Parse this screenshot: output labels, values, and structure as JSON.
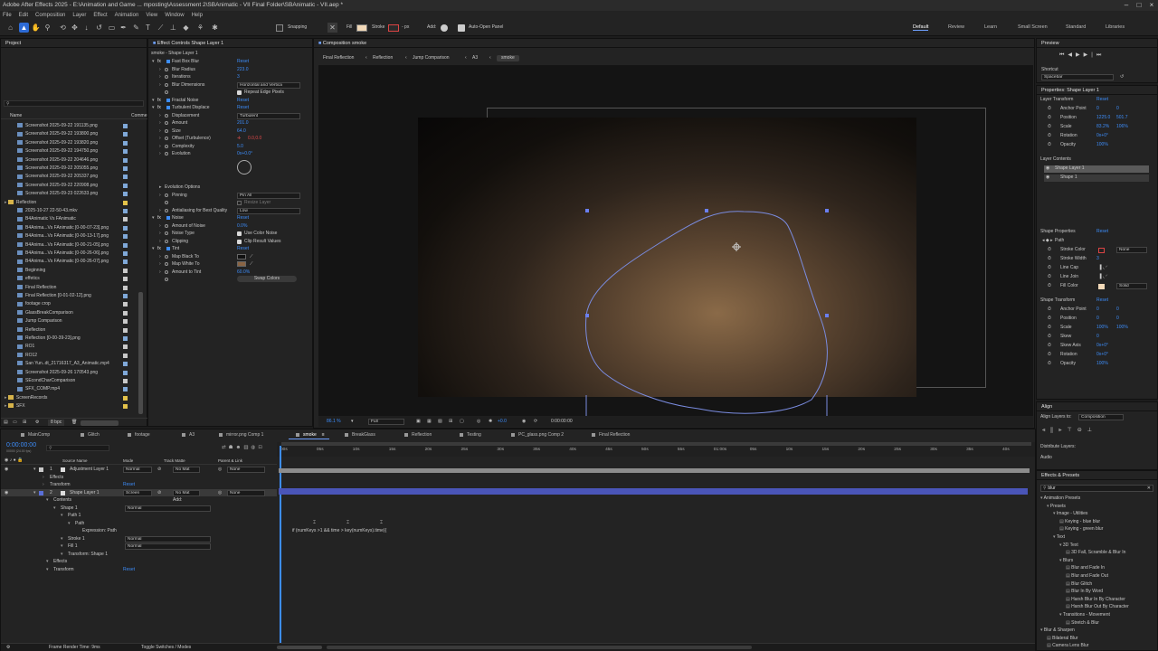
{
  "titlebar": {
    "title": "Adobe After Effects 2025 - E:\\Animation and Game ... mposting\\Assessment 2\\SBAnimatic - VII Final Folder\\SBAnimatic - VII.aep *"
  },
  "menu": [
    "File",
    "Edit",
    "Composition",
    "Layer",
    "Effect",
    "Animation",
    "View",
    "Window",
    "Help"
  ],
  "toolbar": {
    "snapping": "Snapping",
    "fill": "Fill",
    "stroke": "Stroke",
    "stroke_value": "- px",
    "add": "Add:",
    "auto_open": "Auto-Open Panel",
    "workspaces": [
      "Default",
      "Review",
      "Learn",
      "Small Screen",
      "Standard",
      "Libraries"
    ],
    "active_workspace": "Default"
  },
  "project": {
    "title": "Project",
    "col_name": "Name",
    "col_comment": "Comme",
    "search_placeholder": "",
    "items": [
      "Screenshot 2025-09-22 191135.png",
      "Screenshot 2025-09-22 193800.png",
      "Screenshot 2025-09-22 193820.png",
      "Screenshot 2025-09-22 194750.png",
      "Screenshot 2025-09-22 204646.png",
      "Screenshot 2025-09-22 205055.png",
      "Screenshot 2025-09-22 205337.png",
      "Screenshot 2025-09-22 220908.png",
      "Screenshot 2025-09-23 022633.png",
      "Reflection",
      "2025-10-27 22-50-43.mkv",
      "B4Animatic Vs FAnimatic",
      "B4Anima...Vs FAnimatic [0-00-07-23].png",
      "B4Anima...Vs FAnimatic [0-00-13-17].png",
      "B4Anima...Vs FAnimatic [0-00-21-05].png",
      "B4Anima...Vs FAnimatic [0-00-26-06].png",
      "B4Anima...Vs FAnimatic [0-00-26-07].png",
      "Beginning",
      "effetics",
      "Final Reflection",
      "Final Reflection [0-01-02-12].png",
      "footage crop",
      "GlassBreakComparison",
      "Jump Comparison",
      "Reflection",
      "Reflection [0-00-39-23].png",
      "RO1",
      "RO12",
      "San Yun..dt_21716317_A3_Animatic.mp4",
      "Screenshot 2025-09-26 170543.png",
      "SEcondCharComparison",
      "SFX_COMP.mp4",
      "ScreenRecords",
      "SFX"
    ],
    "colors": [
      "#7fa8d8",
      "#7fa8d8",
      "#7fa8d8",
      "#7fa8d8",
      "#7fa8d8",
      "#7fa8d8",
      "#7fa8d8",
      "#7fa8d8",
      "#7fa8d8",
      "#e3c24a",
      "#7fa8d8",
      "#c9c9c9",
      "#7fa8d8",
      "#7fa8d8",
      "#7fa8d8",
      "#7fa8d8",
      "#7fa8d8",
      "#c9c9c9",
      "#c9c9c9",
      "#c9c9c9",
      "#7fa8d8",
      "#c9c9c9",
      "#c9c9c9",
      "#c9c9c9",
      "#c9c9c9",
      "#7fa8d8",
      "#c9c9c9",
      "#c9c9c9",
      "#7fa8d8",
      "#7fa8d8",
      "#c9c9c9",
      "#7fa8d8",
      "#e3c24a",
      "#e3c24a"
    ],
    "bpc": "8 bpc"
  },
  "effects": {
    "title": "Effect Controls Shape Layer 1",
    "subtitle": "smoke - Shape Layer 1",
    "rows": [
      {
        "label": "Fast Box Blur",
        "value": "Reset",
        "kind": "fx"
      },
      {
        "label": "Blur Radius",
        "value": "223.0",
        "kind": "num"
      },
      {
        "label": "Iterations",
        "value": "3",
        "kind": "num"
      },
      {
        "label": "Blur Dimensions",
        "value": "Horizontal and Vertica",
        "kind": "dd"
      },
      {
        "label": "",
        "value": "Repeat Edge Pixels",
        "kind": "chk"
      },
      {
        "label": "Fractal Noise",
        "value": "Reset",
        "kind": "fx"
      },
      {
        "label": "Turbulent Displace",
        "value": "Reset",
        "kind": "fx"
      },
      {
        "label": "Displacement",
        "value": "Turbulent",
        "kind": "dd"
      },
      {
        "label": "Amount",
        "value": "201.0",
        "kind": "num"
      },
      {
        "label": "Size",
        "value": "64.0",
        "kind": "num"
      },
      {
        "label": "Offset (Turbulence)",
        "value": "0.0,0.0",
        "kind": "red"
      },
      {
        "label": "Complexity",
        "value": "5.0",
        "kind": "num"
      },
      {
        "label": "Evolution",
        "value": "0x+0.0°",
        "kind": "num"
      },
      {
        "label": "",
        "value": "",
        "kind": "dial"
      },
      {
        "label": "",
        "value": "",
        "kind": "blank"
      },
      {
        "label": "Evolution Options",
        "value": "",
        "kind": "sub"
      },
      {
        "label": "Pinning",
        "value": "Pin All",
        "kind": "dd"
      },
      {
        "label": "",
        "value": "Resize Layer",
        "kind": "chkoff"
      },
      {
        "label": "Antialiasing for Best Quality",
        "value": "Low",
        "kind": "dd"
      },
      {
        "label": "Noise",
        "value": "Reset",
        "kind": "fx"
      },
      {
        "label": "Amount of Noise",
        "value": "0.0%",
        "kind": "num"
      },
      {
        "label": "Noise Type",
        "value": "Use Color Noise",
        "kind": "chk"
      },
      {
        "label": "Clipping",
        "value": "Clip Result Values",
        "kind": "chk"
      },
      {
        "label": "Tint",
        "value": "Reset",
        "kind": "fx"
      },
      {
        "label": "Map Black To",
        "value": "",
        "kind": "colorblack"
      },
      {
        "label": "Map White To",
        "value": "",
        "kind": "colorbrown"
      },
      {
        "label": "Amount to Tint",
        "value": "60.0%",
        "kind": "num"
      },
      {
        "label": "",
        "value": "Swap Colors",
        "kind": "btn"
      }
    ]
  },
  "composition": {
    "title": "Composition smoke",
    "breadcrumbs": [
      "Final Reflection",
      "Reflection",
      "Jump Comparison",
      "A3",
      "smoke"
    ],
    "zoom": "86.1 %",
    "quality": "Full",
    "timecode": "0:00:00:00",
    "exposure": "+0.0"
  },
  "preview": {
    "title": "Preview",
    "shortcut_label": "Shortcut",
    "shortcut_value": "Spacebar"
  },
  "properties": {
    "title": "Properties: Shape Layer 1",
    "layer_transform": "Layer Transform",
    "reset": "Reset",
    "transform": [
      {
        "label": "Anchor Point",
        "v1": "0",
        "v2": "0"
      },
      {
        "label": "Position",
        "v1": "1225.0",
        "v2": "501.7"
      },
      {
        "label": "Scale",
        "v1": "83.2%",
        "v2": "106%"
      },
      {
        "label": "Rotation",
        "v1": "0x+0°",
        "v2": ""
      },
      {
        "label": "Opacity",
        "v1": "100%",
        "v2": ""
      }
    ],
    "layer_contents": "Layer Contents",
    "contents": [
      "Shape Layer 1",
      "Shape 1"
    ],
    "shape_properties": "Shape Properties",
    "path": "Path",
    "shape_props": [
      {
        "label": "Stroke Color",
        "v": "None"
      },
      {
        "label": "Stroke Width",
        "v": "3"
      },
      {
        "label": "Line Cap",
        "v": ""
      },
      {
        "label": "Line Join",
        "v": ""
      },
      {
        "label": "Fill Color",
        "v": "Solid"
      }
    ],
    "shape_transform": "Shape Transform",
    "shape_tf": [
      {
        "label": "Anchor Point",
        "v1": "0",
        "v2": "0"
      },
      {
        "label": "Position",
        "v1": "0",
        "v2": "0"
      },
      {
        "label": "Scale",
        "v1": "100%",
        "v2": "100%"
      },
      {
        "label": "Skew",
        "v1": "0",
        "v2": ""
      },
      {
        "label": "Skew Axis",
        "v1": "0x+0°",
        "v2": ""
      },
      {
        "label": "Rotation",
        "v1": "0x+0°",
        "v2": ""
      },
      {
        "label": "Opacity",
        "v1": "100%",
        "v2": ""
      }
    ]
  },
  "align": {
    "title": "Align",
    "align_to_label": "Align Layers to:",
    "align_to": "Composition",
    "distribute": "Distribute Layers:",
    "audio": "Audio"
  },
  "effects_presets": {
    "title": "Effects & Presets",
    "search": "blur",
    "tree": [
      {
        "t": "Animation Presets",
        "d": 0
      },
      {
        "t": "Presets",
        "d": 1
      },
      {
        "t": "Image - Utilities",
        "d": 2
      },
      {
        "t": "Keying - blue blur",
        "d": 3
      },
      {
        "t": "Keying - green blur",
        "d": 3
      },
      {
        "t": "Text",
        "d": 2
      },
      {
        "t": "3D Text",
        "d": 3
      },
      {
        "t": "3D Fall, Scramble & Blur In",
        "d": 4
      },
      {
        "t": "Blurs",
        "d": 3
      },
      {
        "t": "Blur and Fade In",
        "d": 4
      },
      {
        "t": "Blur and Fade Out",
        "d": 4
      },
      {
        "t": "Blur Glitch",
        "d": 4
      },
      {
        "t": "Blur In By Word",
        "d": 4
      },
      {
        "t": "Harsh Blur In By Character",
        "d": 4
      },
      {
        "t": "Harsh Blur Out By Character",
        "d": 4
      },
      {
        "t": "Transitions - Movement",
        "d": 3
      },
      {
        "t": "Stretch & Blur",
        "d": 4
      },
      {
        "t": "Blur & Sharpen",
        "d": 0
      },
      {
        "t": "Bilateral Blur",
        "d": 1
      },
      {
        "t": "Camera Lens Blur",
        "d": 1
      }
    ]
  },
  "timeline": {
    "tabs": [
      "MainComp",
      "Glitch",
      "footage",
      "A3",
      "mirror.png Comp 1",
      "smoke",
      "BreakGlass",
      "Reflection",
      "Testing",
      "PC_glass.png Comp 2",
      "Final Reflection"
    ],
    "active_tab": "smoke",
    "timecode": "0:00:00:00",
    "fps": "00000 (24.00 fps)",
    "headers": {
      "source": "Source Name",
      "mode": "Mode",
      "track": "Track Matte",
      "parent": "Parent & Link"
    },
    "layers": [
      {
        "num": "1",
        "name": "Adjustment Layer 1",
        "mode": "Normal",
        "matte": "No Mat",
        "parent": "None",
        "color": "#c9c9c9"
      },
      {
        "num": "2",
        "name": "Shape Layer 1",
        "mode": "Screen",
        "matte": "No Mat",
        "parent": "None",
        "color": "#5a6fd8"
      }
    ],
    "sub": [
      {
        "t": "Effects",
        "d": 1
      },
      {
        "t": "Transform",
        "d": 1,
        "r": "Reset"
      },
      {
        "t": "Contents",
        "d": 1,
        "r": "Add:"
      },
      {
        "t": "Shape 1",
        "d": 2,
        "m": "Normal"
      },
      {
        "t": "Path 1",
        "d": 3
      },
      {
        "t": "Path",
        "d": 4
      },
      {
        "t": "Expression: Path",
        "d": 5
      },
      {
        "t": "Stroke 1",
        "d": 3,
        "m": "Normal"
      },
      {
        "t": "Fill 1",
        "d": 3,
        "m": "Normal"
      },
      {
        "t": "Transform: Shape 1",
        "d": 3
      },
      {
        "t": "Effects",
        "d": 1
      },
      {
        "t": "Transform",
        "d": 1,
        "r": "Reset"
      }
    ],
    "expression": "if (numKeys >1 && time > key(numKeys).time){",
    "ruler": [
      "00s",
      "05s",
      "10s",
      "15s",
      "20s",
      "25s",
      "30s",
      "35s",
      "40s",
      "45s",
      "50s",
      "55s",
      "01:00s",
      "05s",
      "10s",
      "15s",
      "20s",
      "25s",
      "30s",
      "35s",
      "40s"
    ],
    "footer_left": "Frame Render Time: 9ms",
    "footer_mid": "Toggle Switches / Modes"
  }
}
